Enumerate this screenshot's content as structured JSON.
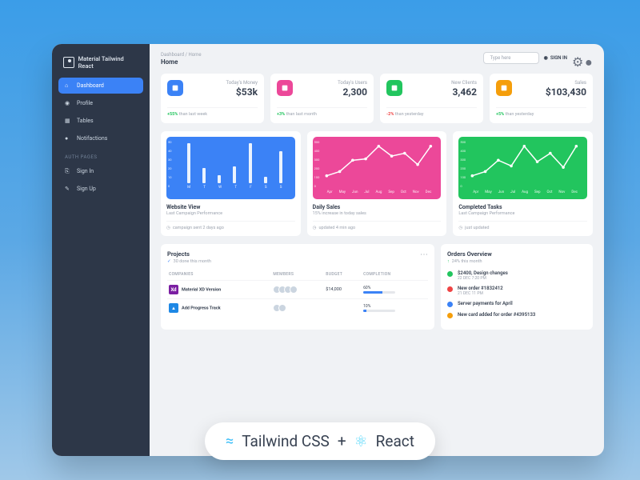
{
  "brand": "Material Tailwind React",
  "sidebar": {
    "items": [
      {
        "label": "Dashboard",
        "icon": "home"
      },
      {
        "label": "Profile",
        "icon": "user"
      },
      {
        "label": "Tables",
        "icon": "table"
      },
      {
        "label": "Notifactions",
        "icon": "bell"
      }
    ],
    "auth_label": "AUTH PAGES",
    "auth_items": [
      {
        "label": "Sign In",
        "icon": "login"
      },
      {
        "label": "Sign Up",
        "icon": "signup"
      }
    ]
  },
  "breadcrumb": "Dashboard  /  Home",
  "page_title": "Home",
  "search_placeholder": "Type here",
  "signin_label": "SIGN IN",
  "stats": [
    {
      "label": "Today's Money",
      "value": "$53k",
      "delta": "+55%",
      "delta_dir": "up",
      "delta_text": "than last week",
      "icon": "ic-blue"
    },
    {
      "label": "Today's Users",
      "value": "2,300",
      "delta": "+3%",
      "delta_dir": "up",
      "delta_text": "than last month",
      "icon": "ic-pink"
    },
    {
      "label": "New Clients",
      "value": "3,462",
      "delta": "-2%",
      "delta_dir": "down",
      "delta_text": "than yesterday",
      "icon": "ic-green"
    },
    {
      "label": "Sales",
      "value": "$103,430",
      "delta": "+5%",
      "delta_dir": "up",
      "delta_text": "than yesterday",
      "icon": "ic-orange"
    }
  ],
  "charts": [
    {
      "title": "Website View",
      "sub": "Last Campaign Performance",
      "meta": "campaign sent 2 days ago",
      "css": "cb-blue",
      "type": "bar"
    },
    {
      "title": "Daily Sales",
      "sub": "15% increase in today sales",
      "meta": "updated 4 min ago",
      "css": "cb-pink",
      "type": "line"
    },
    {
      "title": "Completed Tasks",
      "sub": "Last Campaign Performance",
      "meta": "just updated",
      "css": "cb-green",
      "type": "line"
    }
  ],
  "chart_data": [
    {
      "type": "bar",
      "categories": [
        "M",
        "T",
        "W",
        "T",
        "F",
        "S",
        "S"
      ],
      "values": [
        48,
        18,
        10,
        20,
        48,
        8,
        38
      ],
      "ylim": [
        0,
        50
      ],
      "yticks": [
        0,
        10,
        20,
        30,
        40,
        50
      ]
    },
    {
      "type": "line",
      "categories": [
        "Apr",
        "May",
        "Jun",
        "Jul",
        "Aug",
        "Sep",
        "Oct",
        "Nov",
        "Dec"
      ],
      "values": [
        60,
        120,
        280,
        300,
        480,
        340,
        380,
        220,
        480
      ],
      "ylim": [
        0,
        500
      ],
      "yticks": [
        0,
        100,
        200,
        300,
        400,
        500
      ]
    },
    {
      "type": "line",
      "categories": [
        "Apr",
        "May",
        "Jun",
        "Jul",
        "Aug",
        "Sep",
        "Oct",
        "Nov",
        "Dec"
      ],
      "values": [
        60,
        120,
        280,
        200,
        480,
        260,
        380,
        180,
        480
      ],
      "ylim": [
        0,
        500
      ],
      "yticks": [
        0,
        100,
        200,
        300,
        400,
        500
      ]
    }
  ],
  "projects": {
    "title": "Projects",
    "sub": "30 done this month",
    "columns": [
      "COMPANIES",
      "MEMBERS",
      "BUDGET",
      "COMPLETION"
    ],
    "rows": [
      {
        "name": "Material XD Version",
        "logo_bg": "#7b1fa2",
        "logo_txt": "Xd",
        "members": 4,
        "budget": "$14,000",
        "completion": 60
      },
      {
        "name": "Add Progress Track",
        "logo_bg": "#1e88e5",
        "logo_txt": "▲",
        "members": 2,
        "budget": "",
        "completion": 10
      }
    ]
  },
  "orders": {
    "title": "Orders Overview",
    "sub": "24% this month",
    "items": [
      {
        "color": "#22c55e",
        "title": "$2400, Design changes",
        "time": "22 DEC 7:20 PM"
      },
      {
        "color": "#ef4444",
        "title": "New order #1832412",
        "time": "21 DEC 11 PM"
      },
      {
        "color": "#3b82f6",
        "title": "Server payments for April",
        "time": ""
      },
      {
        "color": "#f59e0b",
        "title": "New card added for order #4395133",
        "time": ""
      }
    ]
  },
  "promo": {
    "text1": "Tailwind CSS",
    "plus": "+",
    "text2": "React"
  }
}
